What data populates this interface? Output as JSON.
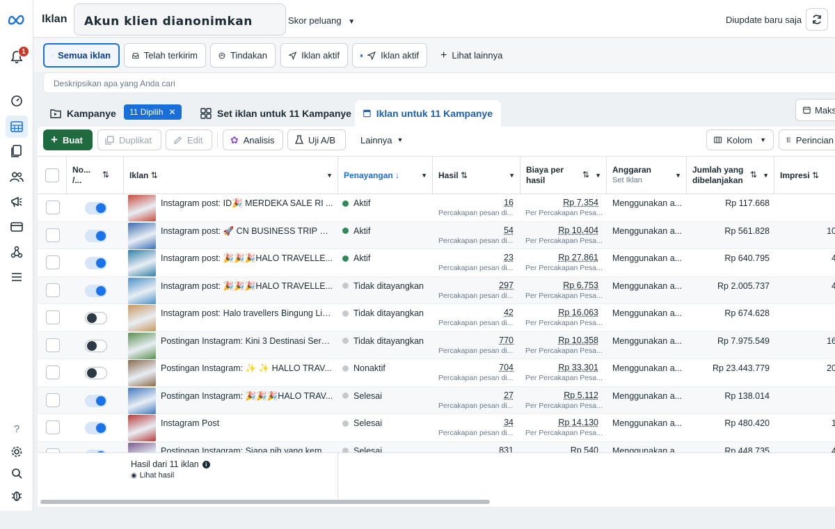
{
  "topbar": {
    "title": "Iklan",
    "account_label": "Akun klien dianonimkan",
    "opportunity_score": "Skor peluang",
    "updated": "Diupdate baru saja"
  },
  "notifications": {
    "count": "1"
  },
  "filter_tabs": [
    {
      "label": "Semua iklan",
      "icon": "folder-icon"
    },
    {
      "label": "Telah terkirim",
      "icon": "inbox-icon"
    },
    {
      "label": "Tindakan",
      "icon": "action-icon"
    },
    {
      "label": "Iklan aktif",
      "icon": "send-icon"
    },
    {
      "label": "Iklan aktif",
      "icon": "send-icon"
    },
    {
      "label": "Lihat lainnya",
      "icon": "plus-icon"
    }
  ],
  "search": {
    "placeholder": "Deskripsikan apa yang Anda cari"
  },
  "level_tabs": {
    "campaign": "Kampanye",
    "selected_chip": "11 Dipilih",
    "adsets": "Set iklan untuk 11 Kampanye",
    "ads": "Iklan untuk 11 Kampanye",
    "maks": "Maks"
  },
  "toolbar": {
    "create": "Buat",
    "duplicate": "Duplikat",
    "edit": "Edit",
    "analysis": "Analisis",
    "ab_test": "Uji A/B",
    "more": "Lainnya",
    "columns": "Kolom",
    "breakdown": "Perincian"
  },
  "columns": {
    "onoff_line1": "No...",
    "onoff_line2": "/...",
    "ad": "Iklan",
    "delivery": "Penayangan",
    "results": "Hasil",
    "cost_line1": "Biaya per",
    "cost_line2": "hasil",
    "budget": "Anggaran",
    "budget_sub": "Set Iklan",
    "spent_line1": "Jumlah yang",
    "spent_line2": "dibelanjakan",
    "impressions": "Impresi"
  },
  "rows": [
    {
      "name": "Instagram post: ID🎉 MERDEKA SALE RI ...",
      "status": "Aktif",
      "status_color": "#2e8b57",
      "on": true,
      "result": "16",
      "result_sub": "Percakapan pesan di...",
      "cost": "Rp 7.354",
      "cost_sub": "Per Percakapan Pesa...",
      "budget": "Menggunakan a...",
      "spent": "Rp 117.668",
      "impr": "",
      "thumb": "#c84a3c"
    },
    {
      "name": "Instagram post: 🚀 CN BUSINESS TRIP SA...",
      "status": "Aktif",
      "status_color": "#2e8b57",
      "on": true,
      "result": "54",
      "result_sub": "Percakapan pesan di...",
      "cost": "Rp 10.404",
      "cost_sub": "Per Percakapan Pesa...",
      "budget": "Menggunakan a...",
      "spent": "Rp 561.828",
      "impr": "10",
      "thumb": "#3c6bb0"
    },
    {
      "name": "Instagram post: 🎉🎉🎉HALO TRAVELLE...",
      "status": "Aktif",
      "status_color": "#2e8b57",
      "on": true,
      "result": "23",
      "result_sub": "Percakapan pesan di...",
      "cost": "Rp 27.861",
      "cost_sub": "Per Percakapan Pesa...",
      "budget": "Menggunakan a...",
      "spent": "Rp 640.795",
      "impr": "4",
      "thumb": "#2f7fa8"
    },
    {
      "name": "Instagram post: 🎉🎉🎉HALO TRAVELLE...",
      "status": "Tidak ditayangkan",
      "status_color": "#c4c9ce",
      "on": true,
      "result": "297",
      "result_sub": "Percakapan pesan di...",
      "cost": "Rp 6.753",
      "cost_sub": "Per Percakapan Pesa...",
      "budget": "Menggunakan a...",
      "spent": "Rp 2.005.737",
      "impr": "4",
      "thumb": "#4a90c8"
    },
    {
      "name": "Instagram post: Halo travellers Bingung Lib...",
      "status": "Tidak ditayangkan",
      "status_color": "#c4c9ce",
      "on": false,
      "result": "42",
      "result_sub": "Percakapan pesan di...",
      "cost": "Rp 16.063",
      "cost_sub": "Per Percakapan Pesa...",
      "budget": "Menggunakan a...",
      "spent": "Rp 674.628",
      "impr": "",
      "thumb": "#c9965f"
    },
    {
      "name": "Postingan Instagram: Kini 3 Destinasi Seru ...",
      "status": "Tidak ditayangkan",
      "status_color": "#c4c9ce",
      "on": false,
      "result": "770",
      "result_sub": "Percakapan pesan di...",
      "cost": "Rp 10.358",
      "cost_sub": "Per Percakapan Pesa...",
      "budget": "Menggunakan a...",
      "spent": "Rp 7.975.549",
      "impr": "16",
      "thumb": "#5a8f4e"
    },
    {
      "name": "Postingan Instagram: ✨ ✨ HALLO TRAV...",
      "status": "Nonaktif",
      "status_color": "#c4c9ce",
      "on": false,
      "result": "704",
      "result_sub": "Percakapan pesan di...",
      "cost": "Rp 33.301",
      "cost_sub": "Per Percakapan Pesa...",
      "budget": "Menggunakan a...",
      "spent": "Rp 23.443.779",
      "impr": "20",
      "thumb": "#8a6a4e"
    },
    {
      "name": "Postingan Instagram: 🎉🎉🎉HALO TRAV...",
      "status": "Selesai",
      "status_color": "#c4c9ce",
      "on": true,
      "result": "27",
      "result_sub": "Percakapan pesan di...",
      "cost": "Rp 5.112",
      "cost_sub": "Per Percakapan Pesa...",
      "budget": "Menggunakan a...",
      "spent": "Rp 138.014",
      "impr": "",
      "thumb": "#3f78c0"
    },
    {
      "name": "Instagram Post",
      "status": "Selesai",
      "status_color": "#c4c9ce",
      "on": true,
      "result": "34",
      "result_sub": "Percakapan pesan di...",
      "cost": "Rp 14.130",
      "cost_sub": "Per Percakapan Pesa...",
      "budget": "Menggunakan a...",
      "spent": "Rp 480.420",
      "impr": "1",
      "thumb": "#b83a3a"
    },
    {
      "name": "Postingan Instagram: Siapa nih yang kemar...",
      "status": "Selesai",
      "status_color": "#c4c9ce",
      "on": true,
      "result": "831",
      "result_sub": "",
      "cost": "Rp 540",
      "cost_sub": "",
      "budget": "Menggunakan a...",
      "spent": "Rp 448.735",
      "impr": "4",
      "thumb": "#7a5c8f"
    }
  ],
  "footer": {
    "results_label": "Hasil dari 11 iklan",
    "view_results": "Lihat hasil"
  }
}
